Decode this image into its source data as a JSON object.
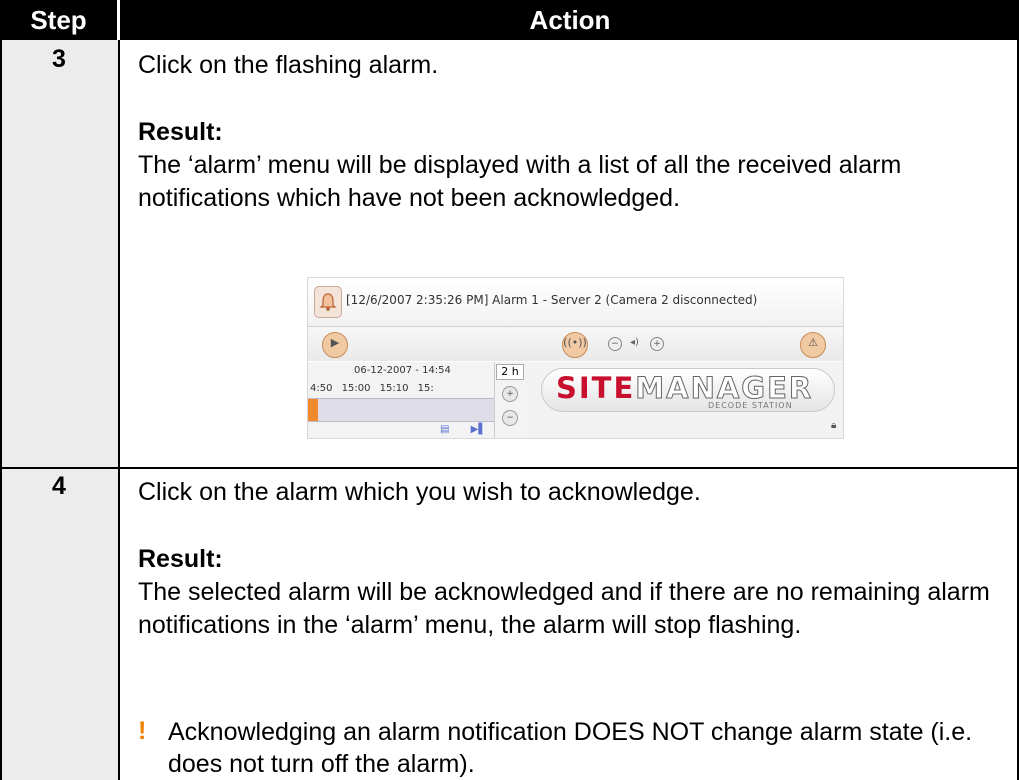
{
  "table": {
    "header": {
      "step": "Step",
      "action": "Action"
    },
    "rows": [
      {
        "step": "3",
        "instruction": "Click on the flashing alarm.",
        "result_label": "Result:",
        "result_text": "The ‘alarm’ menu will be displayed with a list of all the received alarm notifications which have not been acknowledged."
      },
      {
        "step": "4",
        "instruction": "Click on the alarm which you wish to acknowledge.",
        "result_label": "Result:",
        "result_text": "The selected alarm will be acknowledged and if there are no remaining alarm notifications in the ‘alarm’ menu, the alarm will stop flashing.",
        "note_mark": "!",
        "note_text": "Acknowledging an alarm notification DOES NOT change alarm state (i.e. does not turn off the alarm)."
      }
    ]
  },
  "screenshot": {
    "alarm_entry": "[12/6/2007 2:35:26 PM] Alarm 1 - Server 2 (Camera 2 disconnected)",
    "timeline_date": "06-12-2007 - 14:54",
    "timeline_times": "4:50 15:00 15:10 15:",
    "zoom_label": "2 h",
    "logo_red": "SITE",
    "logo_gray": "MANAGER",
    "logo_sub": "DECODE STATION",
    "accent_orange": "#f08a2c",
    "logo_red_color": "#c8102e",
    "icons": [
      "bell-icon",
      "next-icon",
      "broadcast-icon",
      "minus-icon",
      "speaker-icon",
      "plus-icon",
      "alarm-icon",
      "lock-icon"
    ]
  },
  "colors": {
    "header_bg": "#000000",
    "step_bg": "#ececec",
    "warning": "#f08000"
  }
}
